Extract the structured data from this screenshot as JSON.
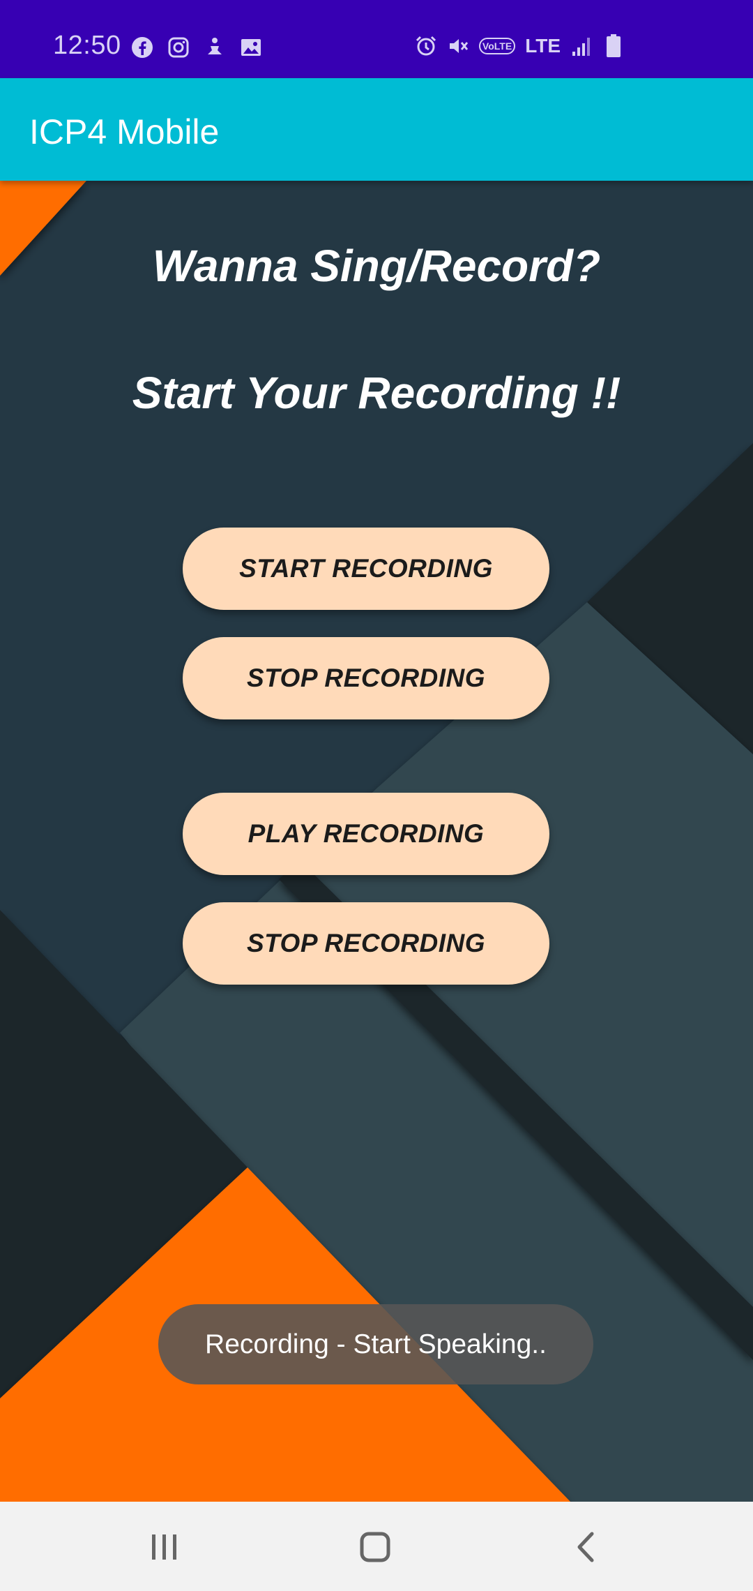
{
  "status_bar": {
    "time": "12:50",
    "left_icons": [
      "facebook-icon",
      "instagram-icon",
      "yoga-icon",
      "gallery-icon"
    ],
    "right_icons": [
      "alarm-icon",
      "mute-icon",
      "volte-icon",
      "lte-label",
      "signal-icon",
      "battery-icon"
    ],
    "volte_label": "VoLTE",
    "lte_label": "LTE",
    "background_color": "#3700b3"
  },
  "app_bar": {
    "title": "ICP4 Mobile",
    "background_color": "#00bcd4"
  },
  "main": {
    "heading_1": "Wanna Sing/Record?",
    "heading_2": "Start Your Recording !!",
    "buttons": {
      "start_recording": "START RECORDING",
      "stop_recording": "STOP RECORDING",
      "play_recording": "PLAY RECORDING",
      "stop_playback": "STOP RECORDING"
    },
    "button_color": "#ffdab9",
    "accent_color": "#ff6d00"
  },
  "toast": {
    "message": "Recording - Start Speaking.."
  },
  "nav_bar": {
    "buttons": [
      "recents-icon",
      "home-icon",
      "back-icon"
    ]
  }
}
